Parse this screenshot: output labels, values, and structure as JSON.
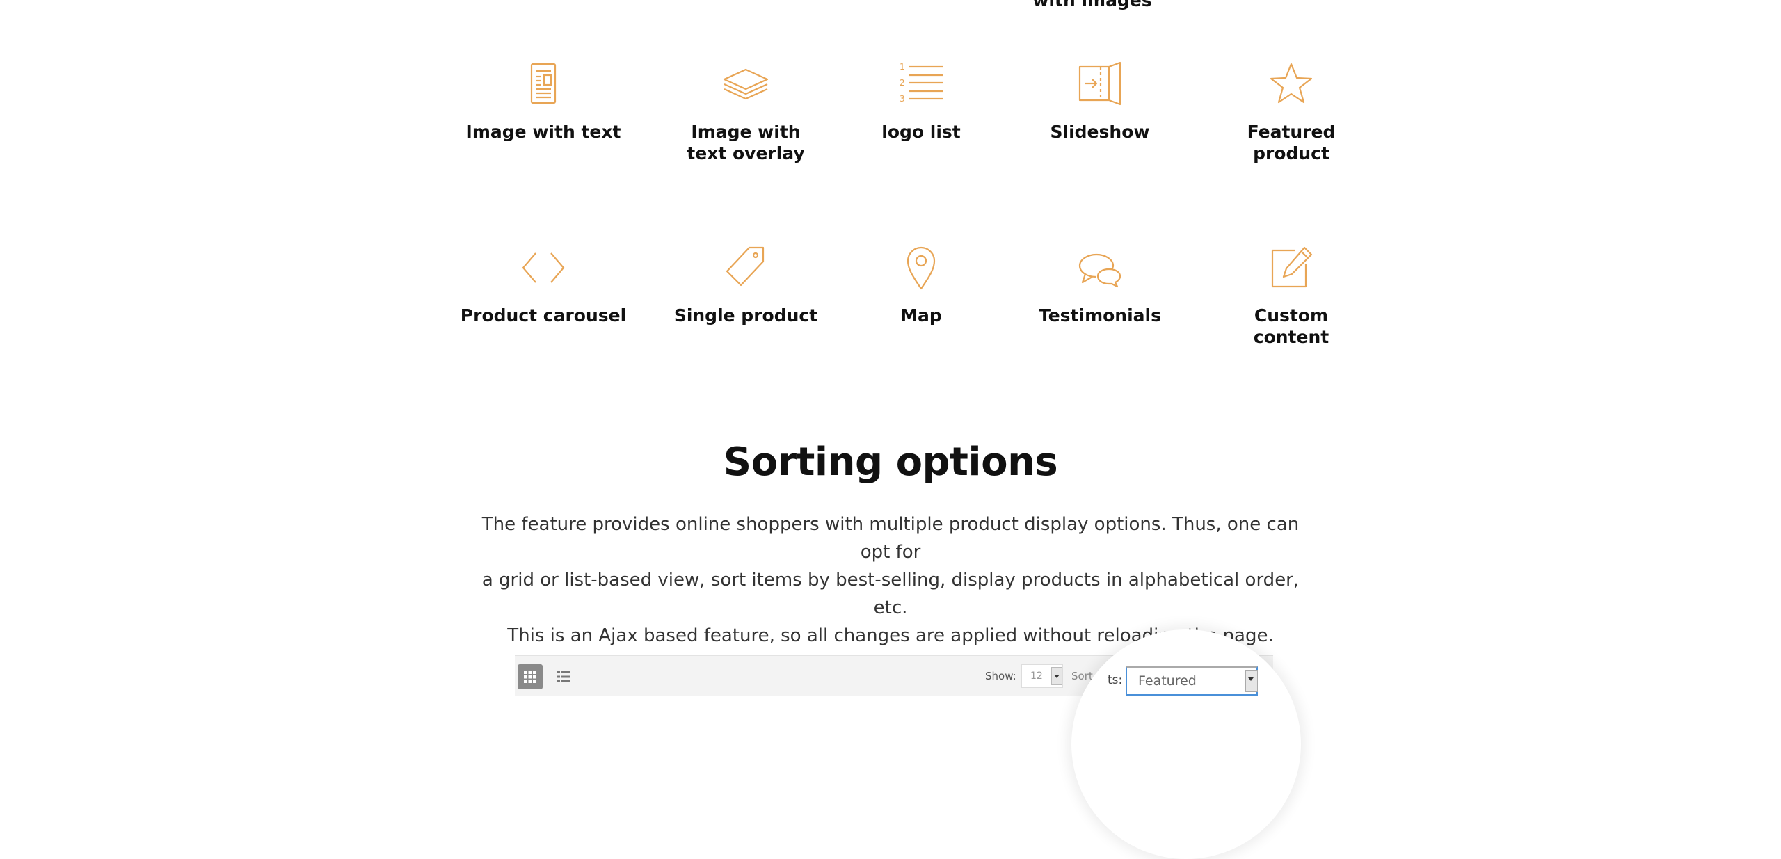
{
  "top_cut_label": "with images",
  "colors": {
    "icon": "#E8A555",
    "accent_border": "#4a90d9"
  },
  "features_row1": [
    {
      "label": "Image with text",
      "icon": "document-icon"
    },
    {
      "label": "Image with\ntext overlay",
      "icon": "layers-icon"
    },
    {
      "label": "logo list",
      "icon": "numbered-list-icon"
    },
    {
      "label": "Slideshow",
      "icon": "slideshow-icon"
    },
    {
      "label": "Featured\nproduct",
      "icon": "star-icon"
    }
  ],
  "features_row2": [
    {
      "label": "Product carousel",
      "icon": "code-brackets-icon"
    },
    {
      "label": "Single product",
      "icon": "tag-icon"
    },
    {
      "label": "Map",
      "icon": "map-pin-icon"
    },
    {
      "label": "Testimonials",
      "icon": "chat-bubbles-icon"
    },
    {
      "label": "Custom\ncontent",
      "icon": "edit-icon"
    }
  ],
  "sorting": {
    "title": "Sorting options",
    "desc_line1": "The feature provides online shoppers with multiple product display options. Thus, one can opt for",
    "desc_line2": "a grid or list-based view, sort items by best-selling, display products in alphabetical order, etc.",
    "desc_line3": "This is an Ajax based feature, so all changes are applied without reloading the page."
  },
  "toolbar": {
    "show_label": "Show:",
    "show_value": "12",
    "sort_label": "Sort pro",
    "mag_label": "ts:",
    "sort_value": "Featured"
  }
}
